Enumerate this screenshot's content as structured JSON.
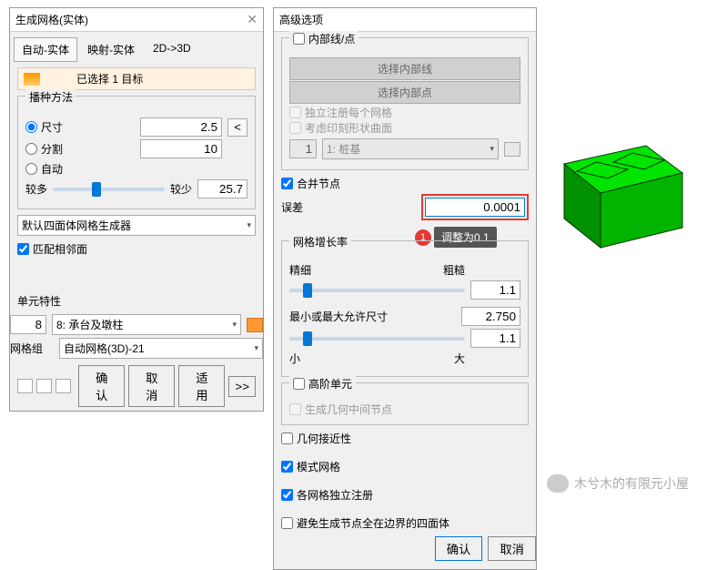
{
  "dialog1": {
    "title": "生成网格(实体)",
    "tabs": [
      "自动-实体",
      "映射-实体",
      "2D->3D"
    ],
    "selected_bar": "已选择 1 目标",
    "seed": {
      "legend": "播种方法",
      "size": "尺寸",
      "size_val": "2.5",
      "div": "分割",
      "div_val": "10",
      "auto": "自动",
      "more": "较多",
      "less": "较少",
      "auto_val": "25.7"
    },
    "generator": "默认四面体网格生成器",
    "match": "匹配相邻面",
    "unit_label": "单元特性",
    "unit_id": "8",
    "unit_sel": "8: 承台及墩柱",
    "group_label": "网格组",
    "group_sel": "自动网格(3D)-21",
    "ok": "确认",
    "cancel": "取消",
    "apply": "适用",
    "expand": ">>"
  },
  "dialog2": {
    "title": "高级选项",
    "inner": {
      "legend": "内部线/点",
      "btn1": "选择内部线",
      "btn2": "选择内部点",
      "cb1": "独立注册每个网格",
      "cb2": "考虑印刻形状曲面",
      "set_n": "1",
      "set_sel": "1: 桩基"
    },
    "merge": {
      "cb": "合并节点",
      "err_label": "误差",
      "err_val": "0.0001"
    },
    "tooltip": {
      "badge": "1",
      "text": "调整为0.1"
    },
    "growth": {
      "legend": "网格增长率",
      "fine": "精细",
      "coarse": "粗糙",
      "val1": "1.1",
      "minmax": "最小或最大允许尺寸",
      "val2": "2.750",
      "small": "小",
      "large": "大",
      "val3": "1.1"
    },
    "high": {
      "legend": "高阶单元",
      "cb": "生成几何中间节点"
    },
    "cb_geom": "几何接近性",
    "cb_mode": "模式网格",
    "cb_indep": "各网格独立注册",
    "cb_avoid": "避免生成节点全在边界的四面体",
    "ok": "确认",
    "cancel": "取消"
  },
  "watermark": "木兮木的有限元小屋"
}
